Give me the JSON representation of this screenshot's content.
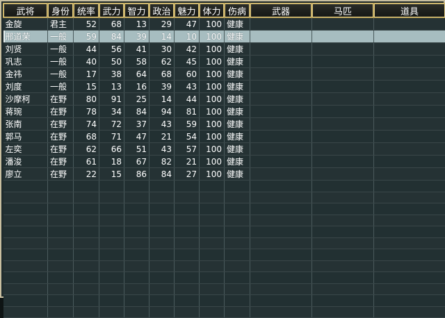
{
  "columns": [
    "武将",
    "身份",
    "统率",
    "武力",
    "智力",
    "政治",
    "魅力",
    "体力",
    "伤病",
    "武器",
    "马匹",
    "道具"
  ],
  "rows": [
    [
      "金旋",
      "君主",
      "52",
      "68",
      "13",
      "29",
      "47",
      "100",
      "健康",
      "",
      "",
      ""
    ],
    [
      "邢道荣",
      "一般",
      "59",
      "84",
      "39",
      "14",
      "10",
      "100",
      "健康",
      "",
      "",
      ""
    ],
    [
      "刘贤",
      "一般",
      "44",
      "56",
      "41",
      "30",
      "42",
      "100",
      "健康",
      "",
      "",
      ""
    ],
    [
      "巩志",
      "一般",
      "40",
      "50",
      "58",
      "62",
      "45",
      "100",
      "健康",
      "",
      "",
      ""
    ],
    [
      "金祎",
      "一般",
      "17",
      "38",
      "64",
      "68",
      "60",
      "100",
      "健康",
      "",
      "",
      ""
    ],
    [
      "刘度",
      "一般",
      "15",
      "13",
      "16",
      "39",
      "43",
      "100",
      "健康",
      "",
      "",
      ""
    ],
    [
      "沙摩柯",
      "在野",
      "80",
      "91",
      "25",
      "14",
      "44",
      "100",
      "健康",
      "",
      "",
      ""
    ],
    [
      "蒋琬",
      "在野",
      "78",
      "34",
      "84",
      "94",
      "81",
      "100",
      "健康",
      "",
      "",
      ""
    ],
    [
      "张南",
      "在野",
      "74",
      "72",
      "37",
      "43",
      "59",
      "100",
      "健康",
      "",
      "",
      ""
    ],
    [
      "郭马",
      "在野",
      "68",
      "71",
      "47",
      "21",
      "54",
      "100",
      "健康",
      "",
      "",
      ""
    ],
    [
      "左奕",
      "在野",
      "62",
      "66",
      "51",
      "43",
      "57",
      "100",
      "健康",
      "",
      "",
      ""
    ],
    [
      "潘浚",
      "在野",
      "61",
      "18",
      "67",
      "82",
      "21",
      "100",
      "健康",
      "",
      "",
      ""
    ],
    [
      "廖立",
      "在野",
      "22",
      "15",
      "86",
      "84",
      "27",
      "100",
      "健康",
      "",
      "",
      ""
    ]
  ],
  "selected_row": 1,
  "empty_row_count": 12,
  "colors": {
    "header_border": "#b59a4d",
    "panel_bg": "#1f2b2d",
    "selected_bg": "#a7bdc0",
    "outer_border": "#c9bfa0"
  }
}
